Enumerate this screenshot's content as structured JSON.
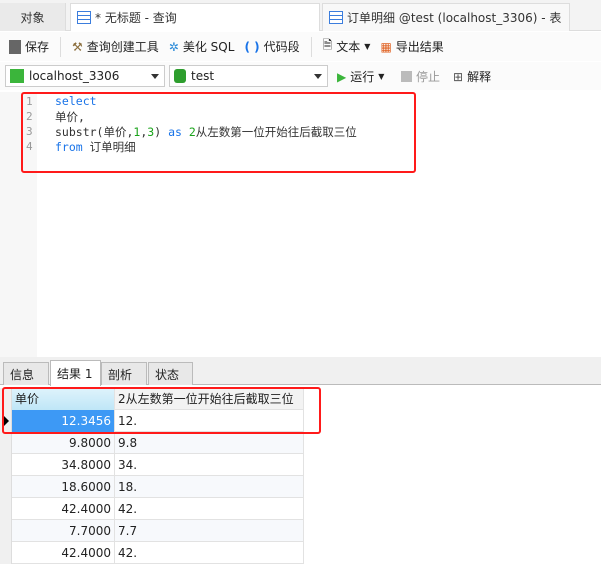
{
  "tabs": [
    {
      "label": "对象"
    },
    {
      "label": "* 无标题 - 查询"
    },
    {
      "label": "订单明细 @test (localhost_3306) - 表"
    }
  ],
  "toolbar": {
    "save": "保存",
    "query_builder": "查询创建工具",
    "beautify": "美化 SQL",
    "snippet": "代码段",
    "text": "文本",
    "export": "导出结果"
  },
  "connection": {
    "server": "localhost_3306",
    "database": "test",
    "run": "运行",
    "stop": "停止",
    "explain": "解释"
  },
  "editor": {
    "line_numbers": [
      "1",
      "2",
      "3",
      "4"
    ]
  },
  "result_tabs": [
    {
      "label": "信息"
    },
    {
      "label": "结果 1"
    },
    {
      "label": "剖析"
    },
    {
      "label": "状态"
    }
  ],
  "grid": {
    "columns": [
      "单价",
      "2从左数第一位开始往后截取三位"
    ],
    "rows": [
      [
        "12.3456",
        "12."
      ],
      [
        "9.8000",
        "9.8"
      ],
      [
        "34.8000",
        "34."
      ],
      [
        "18.6000",
        "18."
      ],
      [
        "42.4000",
        "42."
      ],
      [
        "7.7000",
        "7.7"
      ],
      [
        "42.4000",
        "42."
      ]
    ]
  },
  "colors": {
    "highlight": "#ff1a1a",
    "selected_cell": "#3d99f5",
    "keyword": "#1a74e8"
  }
}
